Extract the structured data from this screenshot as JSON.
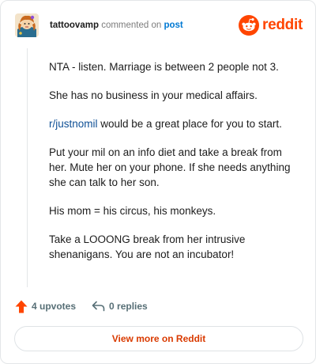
{
  "header": {
    "username": "tattoovamp",
    "verb": "commented on",
    "target": "post",
    "brand": "reddit"
  },
  "comment": {
    "p1": "NTA - listen. Marriage is between 2 people not 3.",
    "p2": "She has no business in your medical affairs.",
    "p3_link": "r/justnomil",
    "p3_rest": " would be a great place for you to start.",
    "p4": "Put your mil on an info diet and take a break from her. Mute her on your phone. If she needs anything she can talk to her son.",
    "p5": "His mom = his circus, his monkeys.",
    "p6": "Take a LOOONG break from her intrusive shenanigans. You are not an incubator!"
  },
  "actions": {
    "upvotes": "4 upvotes",
    "replies": "0 replies"
  },
  "footer": {
    "view_more": "View more on Reddit"
  },
  "colors": {
    "brand": "#ff4500",
    "upvote": "#ff4500",
    "link": "#0079d3",
    "view_more": "#d93a00"
  }
}
